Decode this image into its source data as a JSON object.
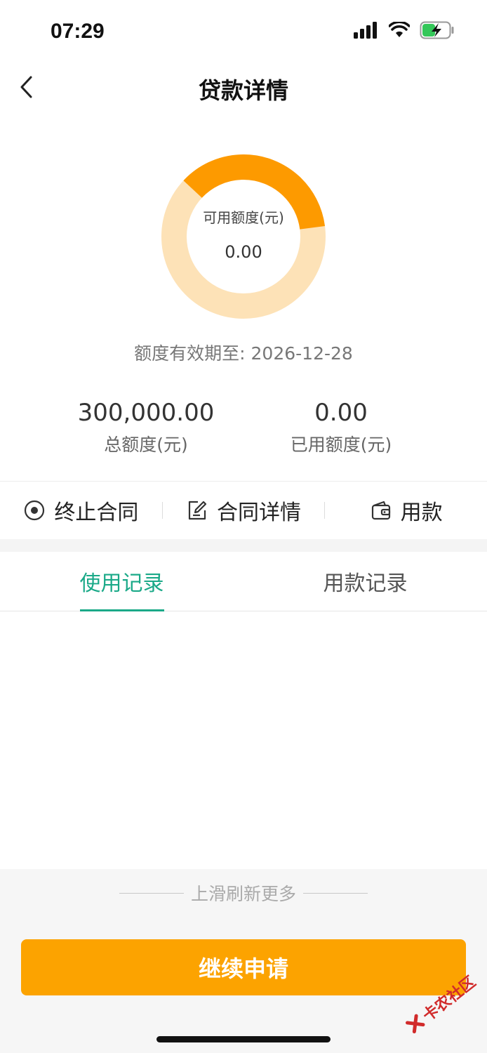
{
  "status_bar": {
    "time": "07:29"
  },
  "nav": {
    "title": "贷款详情"
  },
  "credit": {
    "available_label": "可用额度(元)",
    "available_value": "0.00",
    "used_fraction": 0.36,
    "validity": "额度有效期至: 2026-12-28",
    "total_value": "300,000.00",
    "total_label": "总额度(元)",
    "used_value": "0.00",
    "used_label": "已用额度(元)"
  },
  "actions": [
    {
      "label": "终止合同",
      "icon": "stop-circle-icon"
    },
    {
      "label": "合同详情",
      "icon": "edit-document-icon"
    },
    {
      "label": "用款",
      "icon": "wallet-icon"
    }
  ],
  "tabs": [
    {
      "label": "使用记录",
      "active": true
    },
    {
      "label": "用款记录",
      "active": false
    }
  ],
  "footer": {
    "refresh_hint": "上滑刷新更多",
    "apply_label": "继续申请"
  },
  "watermark": {
    "text": "卡农社区"
  },
  "colors": {
    "accent_green": "#1aa988",
    "donut_orange": "#fd9a00",
    "donut_light": "#fde2b7",
    "button_orange": "#fca300"
  }
}
